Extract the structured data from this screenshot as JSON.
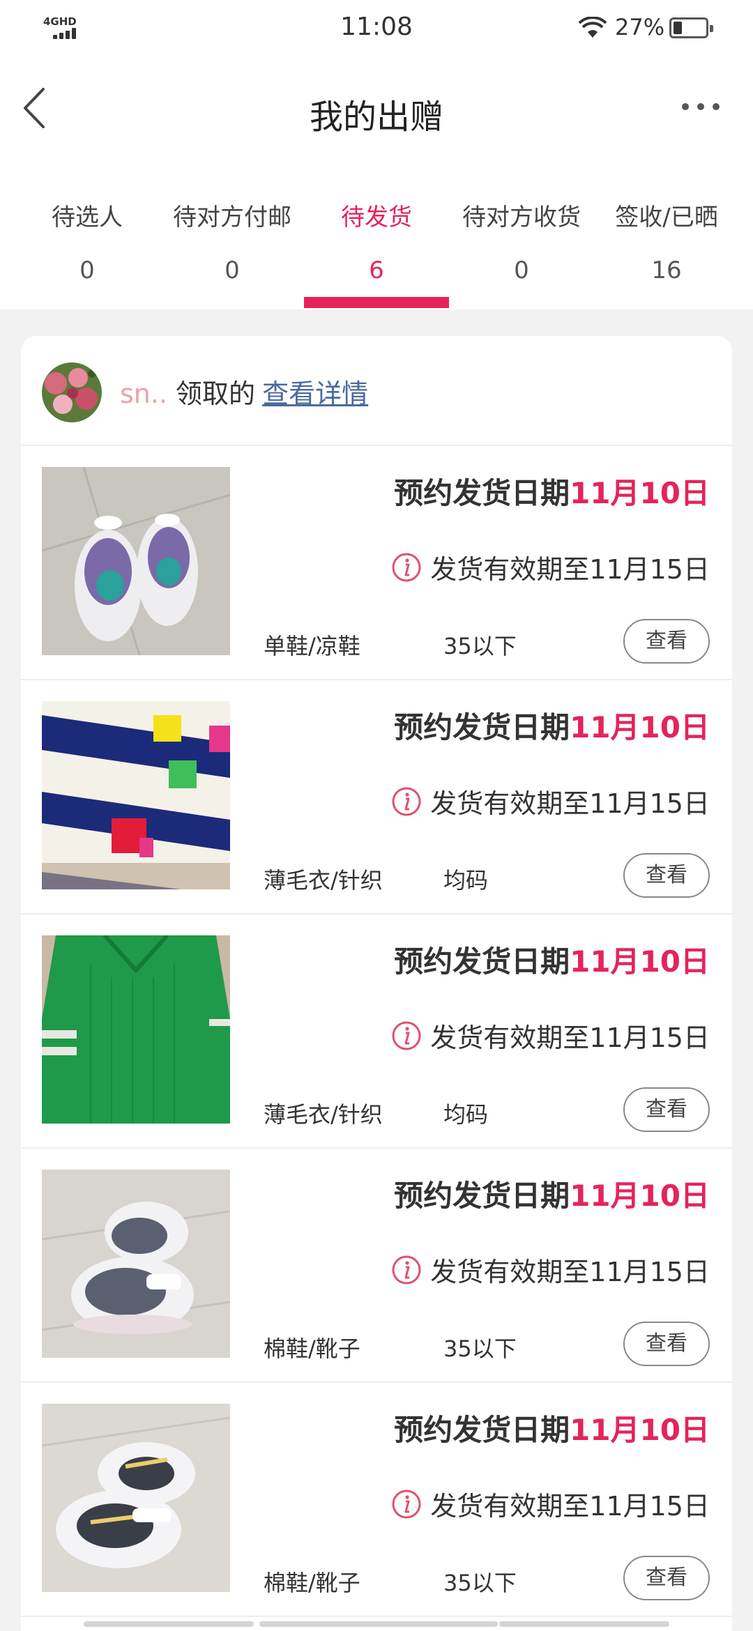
{
  "status_bar": {
    "network": "4GHD",
    "time": "11:08",
    "battery_percent": "27%",
    "battery_level": 0.27
  },
  "nav": {
    "title": "我的出赠",
    "back_icon": "chevron-left-icon",
    "more_icon": "more-horizontal-icon"
  },
  "tabs": [
    {
      "label": "待选人",
      "count": "0",
      "active": false
    },
    {
      "label": "待对方付邮",
      "count": "0",
      "active": false
    },
    {
      "label": "待发货",
      "count": "6",
      "active": true
    },
    {
      "label": "待对方收货",
      "count": "0",
      "active": false
    },
    {
      "label": "签收/已晒",
      "count": "16",
      "active": false
    }
  ],
  "accent_color": "#e4245b",
  "header": {
    "username": "sn..",
    "claimed_text": "领取的",
    "detail_link": "查看详情"
  },
  "items": [
    {
      "schedule_label": "预约发货日期",
      "schedule_date": "11月10日",
      "validity": "发货有效期至11月15日",
      "category": "单鞋/凉鞋",
      "size": "35以下",
      "view": "查看",
      "image": "purple-sneakers"
    },
    {
      "schedule_label": "预约发货日期",
      "schedule_date": "11月10日",
      "validity": "发货有效期至11月15日",
      "category": "薄毛衣/针织",
      "size": "均码",
      "view": "查看",
      "image": "striped-sweater"
    },
    {
      "schedule_label": "预约发货日期",
      "schedule_date": "11月10日",
      "validity": "发货有效期至11月15日",
      "category": "薄毛衣/针织",
      "size": "均码",
      "view": "查看",
      "image": "green-sweater"
    },
    {
      "schedule_label": "预约发货日期",
      "schedule_date": "11月10日",
      "validity": "发货有效期至11月15日",
      "category": "棉鞋/靴子",
      "size": "35以下",
      "view": "查看",
      "image": "grey-sneakers"
    },
    {
      "schedule_label": "预约发货日期",
      "schedule_date": "11月10日",
      "validity": "发货有效期至11月15日",
      "category": "棉鞋/靴子",
      "size": "35以下",
      "view": "查看",
      "image": "white-sneakers"
    }
  ]
}
